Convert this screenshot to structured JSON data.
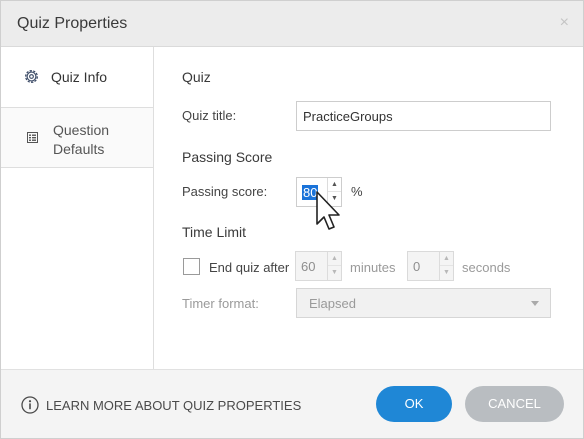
{
  "dialog": {
    "title": "Quiz Properties",
    "close_glyph": "×"
  },
  "sidebar": {
    "items": [
      {
        "label": "Quiz Info",
        "icon": "gear-icon",
        "active": true
      },
      {
        "label_line1": "Question",
        "label_line2": "Defaults",
        "icon": "list-icon",
        "active": false
      }
    ]
  },
  "quiz": {
    "section_title": "Quiz",
    "title_label": "Quiz title:",
    "title_value": "PracticeGroups"
  },
  "passing": {
    "section_title": "Passing Score",
    "score_label": "Passing score:",
    "score_value": "80",
    "unit": "%"
  },
  "time_limit": {
    "section_title": "Time Limit",
    "end_quiz_label": "End quiz after",
    "end_quiz_checked": false,
    "minutes_value": "60",
    "minutes_unit": "minutes",
    "seconds_value": "0",
    "seconds_unit": "seconds",
    "timer_format_label": "Timer format:",
    "timer_format_value": "Elapsed"
  },
  "footer": {
    "learn_more": "LEARN MORE ABOUT QUIZ PROPERTIES",
    "ok_label": "OK",
    "cancel_label": "CANCEL"
  },
  "colors": {
    "accent": "#1f87d6",
    "selection": "#1a73d9",
    "cancel": "#b9bdc1"
  }
}
